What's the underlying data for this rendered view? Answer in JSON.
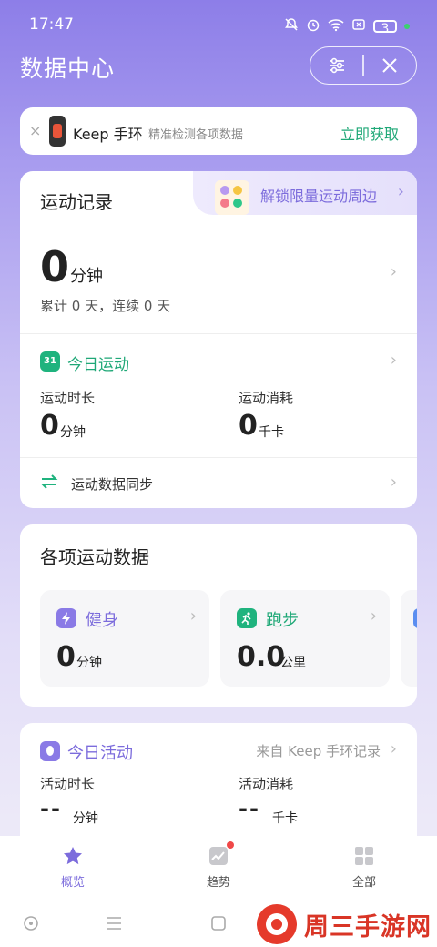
{
  "status_bar": {
    "time": "17:47",
    "battery": "3"
  },
  "header": {
    "title": "数据中心"
  },
  "promo": {
    "close": "×",
    "device_name": "Keep 手环",
    "description": "精准检测各项数据",
    "cta": "立即获取"
  },
  "record_card": {
    "title": "运动记录",
    "merch_label": "解锁限量运动周边",
    "total_value": "0",
    "total_unit": "分钟",
    "cumulative_text": "累计 0 天，连续 0 天",
    "today": {
      "icon_text": "31",
      "label": "今日运动",
      "duration_label": "运动时长",
      "duration_value": "0",
      "duration_unit": "分钟",
      "calories_label": "运动消耗",
      "calories_value": "0",
      "calories_unit": "千卡"
    },
    "sync_label": "运动数据同步"
  },
  "activities_card": {
    "title": "各项运动数据",
    "items": [
      {
        "name": "健身",
        "value": "0",
        "unit": "分钟",
        "icon": "lightning-icon",
        "color": "#8a7ae6"
      },
      {
        "name": "跑步",
        "value": "0.0",
        "unit": "公里",
        "icon": "runner-icon",
        "color": "#1fb37e"
      }
    ]
  },
  "today_activity": {
    "title": "今日活动",
    "source": "来自 Keep 手环记录",
    "duration_label": "活动时长",
    "duration_value": "--",
    "duration_unit": "分钟",
    "calories_label": "活动消耗",
    "calories_value": "--",
    "calories_unit": "千卡"
  },
  "bottom_nav": {
    "items": [
      {
        "label": "概览",
        "icon": "star-icon",
        "active": true
      },
      {
        "label": "趋势",
        "icon": "trend-icon",
        "active": false
      },
      {
        "label": "全部",
        "icon": "grid-icon",
        "active": false
      }
    ]
  },
  "watermark": {
    "text": "周三手游网"
  },
  "colors": {
    "accent_purple": "#7c6cdc",
    "accent_green": "#1fa877"
  }
}
